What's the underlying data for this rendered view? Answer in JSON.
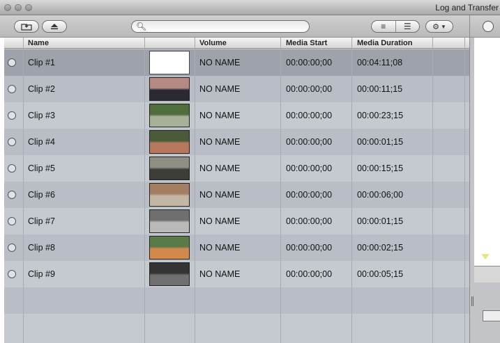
{
  "window": {
    "title": "Log and Transfer"
  },
  "toolbar": {
    "import_icon": "folder-import-icon",
    "eject_icon": "eject-icon",
    "search": {
      "placeholder": ""
    },
    "view_icons": [
      "list-view-icon",
      "indented-list-icon"
    ],
    "gear_icon": "gear-icon"
  },
  "table": {
    "columns": [
      "Name",
      "",
      "Volume",
      "Media Start",
      "Media Duration"
    ],
    "rows": [
      {
        "name": "Clip #1",
        "volume": "NO NAME",
        "media_start": "00:00:00;00",
        "media_duration": "00:04:11;08",
        "selected": true,
        "thumb_colors": [
          "#ffffff",
          "#ffffff"
        ]
      },
      {
        "name": "Clip #2",
        "volume": "NO NAME",
        "media_start": "00:00:00;00",
        "media_duration": "00:00:11;15",
        "selected": false,
        "thumb_colors": [
          "#b78985",
          "#2a2a33"
        ]
      },
      {
        "name": "Clip #3",
        "volume": "NO NAME",
        "media_start": "00:00:00;00",
        "media_duration": "00:00:23;15",
        "selected": false,
        "thumb_colors": [
          "#4f6e3c",
          "#a7b198"
        ]
      },
      {
        "name": "Clip #4",
        "volume": "NO NAME",
        "media_start": "00:00:00;00",
        "media_duration": "00:00:01;15",
        "selected": false,
        "thumb_colors": [
          "#4b5b3a",
          "#b7785d"
        ]
      },
      {
        "name": "Clip #5",
        "volume": "NO NAME",
        "media_start": "00:00:00;00",
        "media_duration": "00:00:15;15",
        "selected": false,
        "thumb_colors": [
          "#8f8f84",
          "#3c3d38"
        ]
      },
      {
        "name": "Clip #6",
        "volume": "NO NAME",
        "media_start": "00:00:00;00",
        "media_duration": "00:00:06;00",
        "selected": false,
        "thumb_colors": [
          "#a47e60",
          "#c3b7a4"
        ]
      },
      {
        "name": "Clip #7",
        "volume": "NO NAME",
        "media_start": "00:00:00;00",
        "media_duration": "00:00:01;15",
        "selected": false,
        "thumb_colors": [
          "#6f6f6f",
          "#b9b9b9"
        ]
      },
      {
        "name": "Clip #8",
        "volume": "NO NAME",
        "media_start": "00:00:00;00",
        "media_duration": "00:00:02;15",
        "selected": false,
        "thumb_colors": [
          "#5a7a48",
          "#d18a4c"
        ]
      },
      {
        "name": "Clip #9",
        "volume": "NO NAME",
        "media_start": "00:00:00;00",
        "media_duration": "00:00:05;15",
        "selected": false,
        "thumb_colors": [
          "#343434",
          "#707070"
        ]
      }
    ]
  }
}
